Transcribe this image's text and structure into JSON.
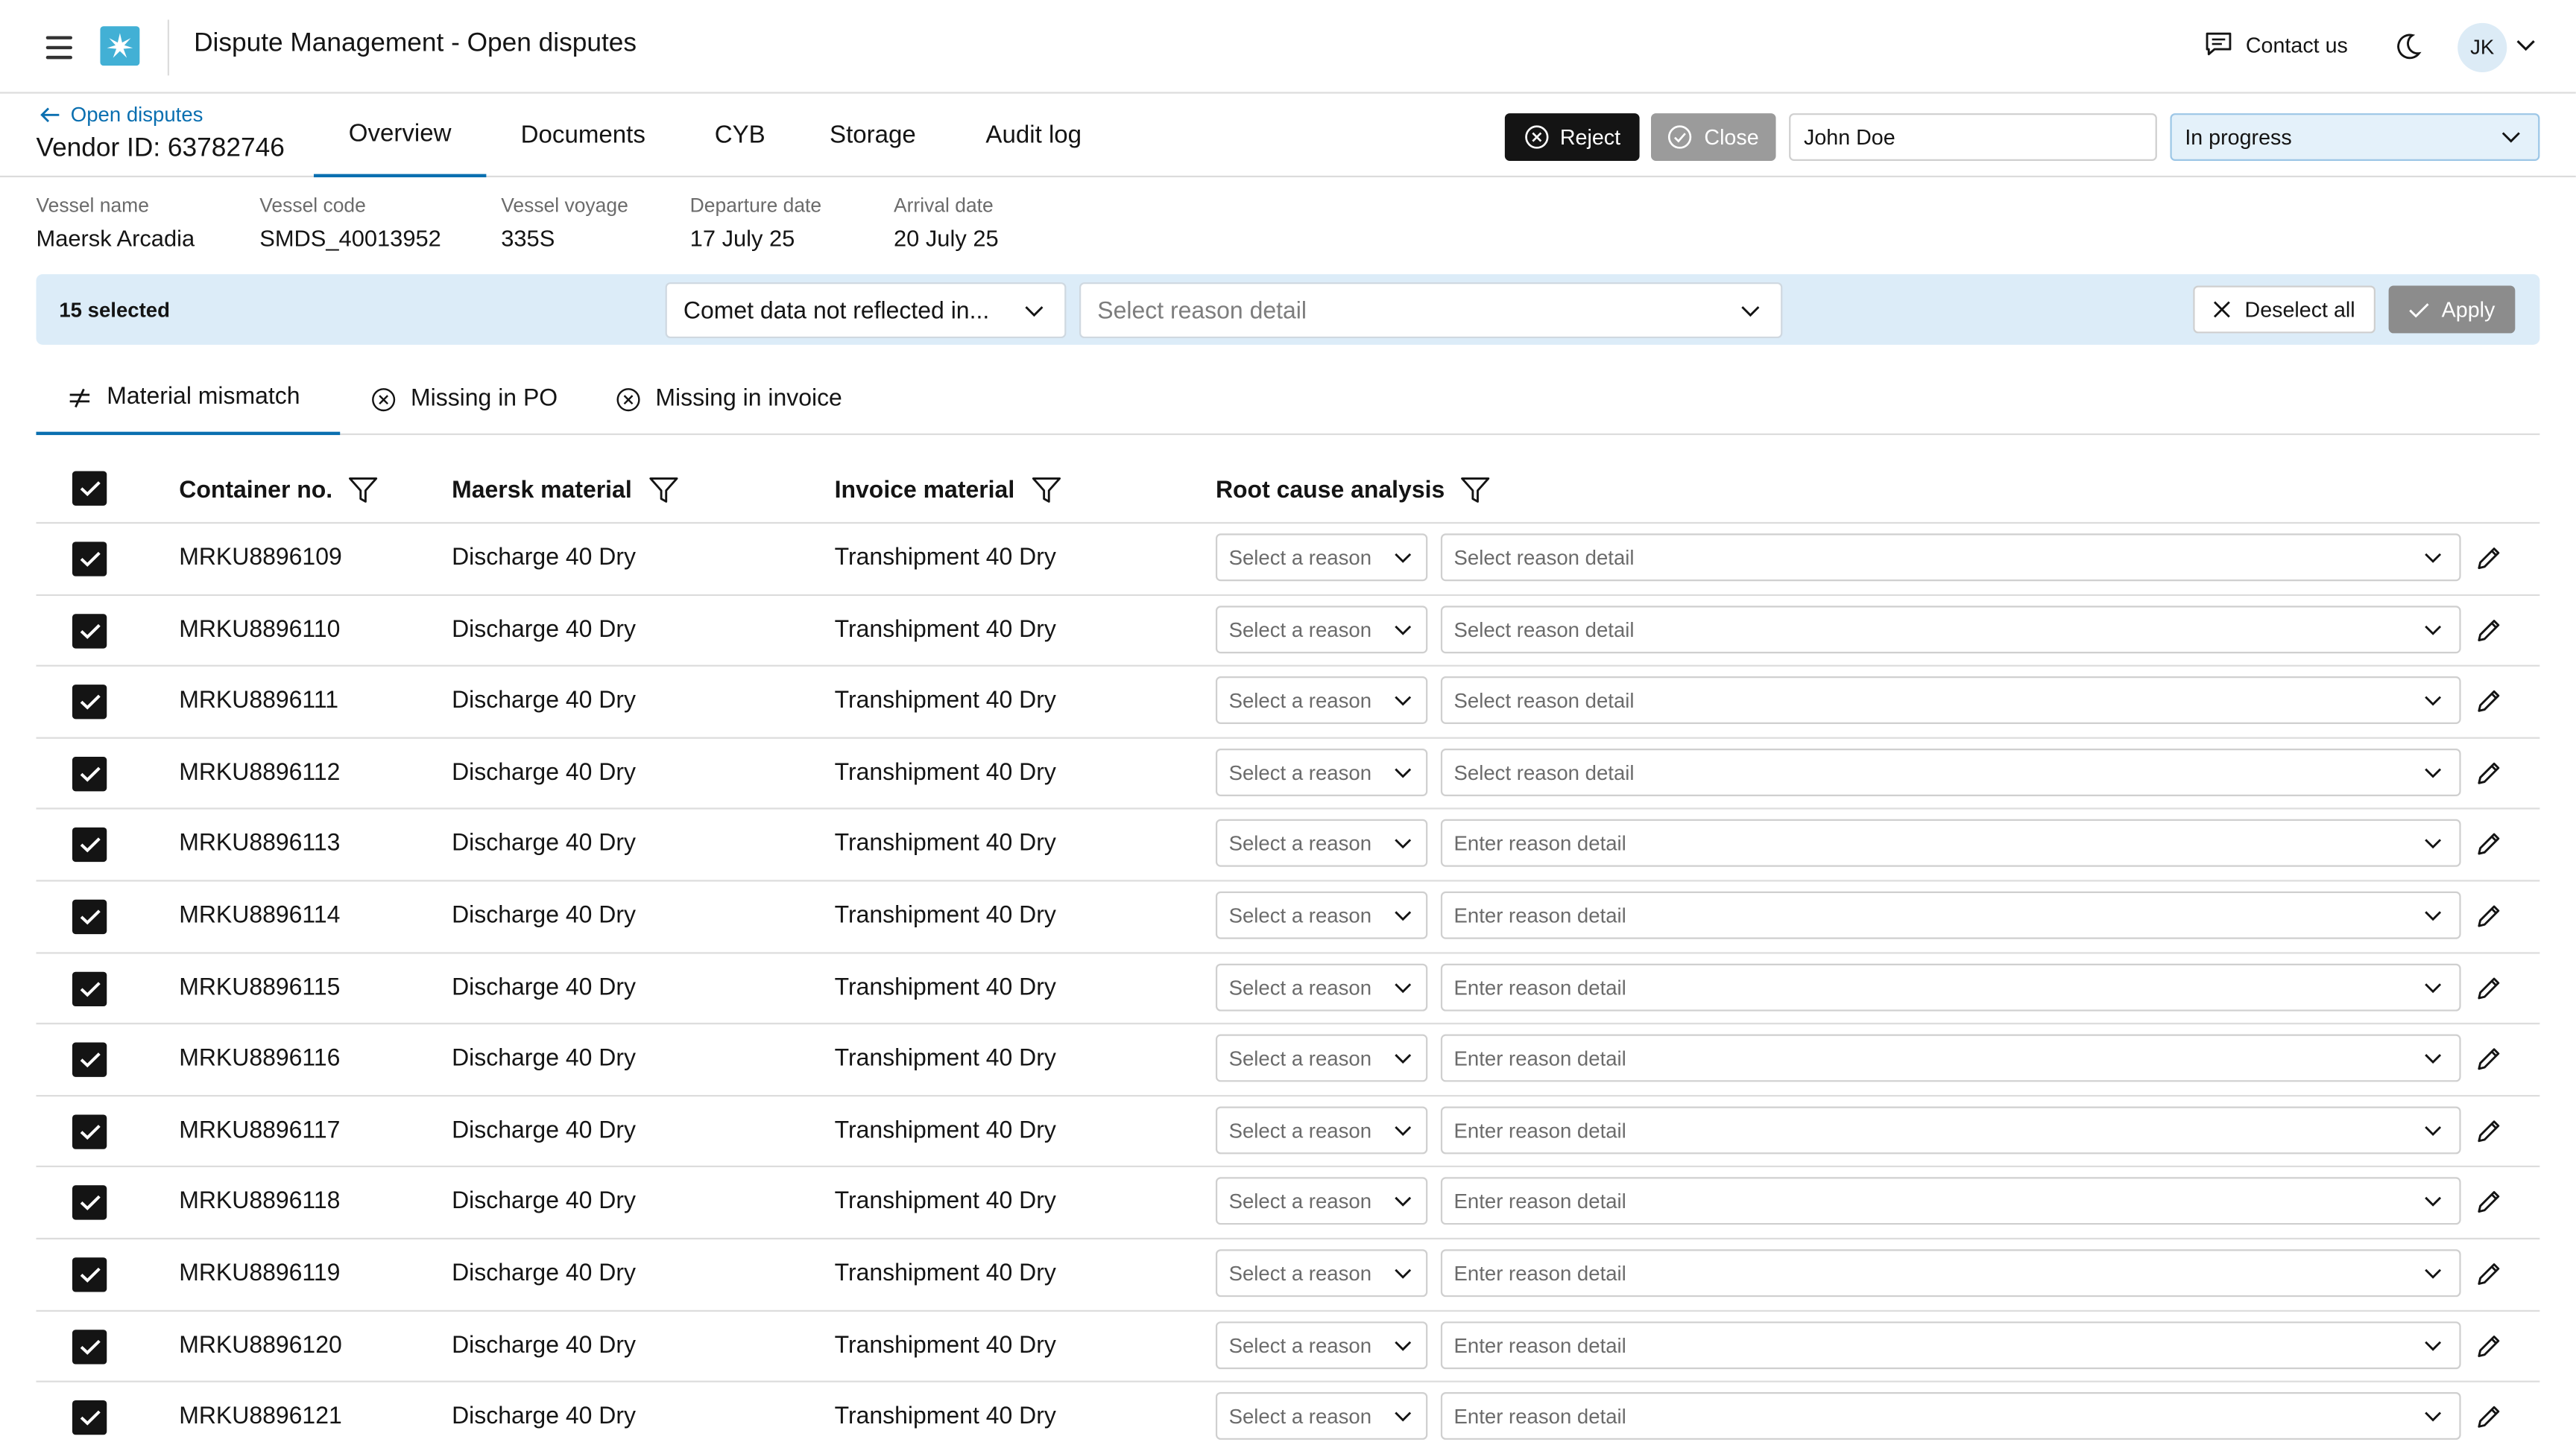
{
  "header": {
    "app_title": "Dispute Management - Open disputes",
    "contact_label": "Contact us",
    "avatar_initials": "JK",
    "brand_color": "#42b0d5"
  },
  "dispute": {
    "back_label": "Open disputes",
    "vendor_id": "Vendor ID: 63782746",
    "tabs": [
      {
        "label": "Overview",
        "active": true
      },
      {
        "label": "Documents",
        "active": false
      },
      {
        "label": "CYB",
        "active": false
      },
      {
        "label": "Storage",
        "active": false
      },
      {
        "label": "Audit log",
        "active": false
      }
    ],
    "reject_label": "Reject",
    "close_label": "Close",
    "assignee": "John Doe",
    "status": "In progress"
  },
  "vessel": {
    "fields": [
      {
        "label": "Vessel name",
        "value": "Maersk Arcadia"
      },
      {
        "label": "Vessel code",
        "value": "SMDS_40013952"
      },
      {
        "label": "Vessel voyage",
        "value": "335S"
      },
      {
        "label": "Departure date",
        "value": "17 July 25"
      },
      {
        "label": "Arrival date",
        "value": "20 July 25"
      }
    ]
  },
  "bulk": {
    "selected_count": "15 selected",
    "reason_value": "Comet data not reflected in...",
    "detail_placeholder": "Select reason detail",
    "deselect_label": "Deselect all",
    "apply_label": "Apply"
  },
  "subtabs": [
    {
      "label": "Material mismatch",
      "icon": "not-equal-icon",
      "active": true
    },
    {
      "label": "Missing in PO",
      "icon": "circle-x-icon",
      "active": false
    },
    {
      "label": "Missing in invoice",
      "icon": "circle-x-icon",
      "active": false
    }
  ],
  "table": {
    "columns": [
      "Container no.",
      "Maersk material",
      "Invoice material",
      "Root cause analysis"
    ],
    "rows": [
      {
        "container": "MRKU8896109",
        "maersk": "Discharge 40 Dry",
        "invoice": "Transhipment 40 Dry",
        "reason": "Select a reason",
        "detail": "Select reason detail",
        "checked": true
      },
      {
        "container": "MRKU8896110",
        "maersk": "Discharge 40 Dry",
        "invoice": "Transhipment 40 Dry",
        "reason": "Select a reason",
        "detail": "Select reason detail",
        "checked": true
      },
      {
        "container": "MRKU8896111",
        "maersk": "Discharge 40 Dry",
        "invoice": "Transhipment 40 Dry",
        "reason": "Select a reason",
        "detail": "Select reason detail",
        "checked": true
      },
      {
        "container": "MRKU8896112",
        "maersk": "Discharge 40 Dry",
        "invoice": "Transhipment 40 Dry",
        "reason": "Select a reason",
        "detail": "Select reason detail",
        "checked": true
      },
      {
        "container": "MRKU8896113",
        "maersk": "Discharge 40 Dry",
        "invoice": "Transhipment 40 Dry",
        "reason": "Select a reason",
        "detail": "Enter reason detail",
        "checked": true
      },
      {
        "container": "MRKU8896114",
        "maersk": "Discharge 40 Dry",
        "invoice": "Transhipment 40 Dry",
        "reason": "Select a reason",
        "detail": "Enter reason detail",
        "checked": true
      },
      {
        "container": "MRKU8896115",
        "maersk": "Discharge 40 Dry",
        "invoice": "Transhipment 40 Dry",
        "reason": "Select a reason",
        "detail": "Enter reason detail",
        "checked": true
      },
      {
        "container": "MRKU8896116",
        "maersk": "Discharge 40 Dry",
        "invoice": "Transhipment 40 Dry",
        "reason": "Select a reason",
        "detail": "Enter reason detail",
        "checked": true
      },
      {
        "container": "MRKU8896117",
        "maersk": "Discharge 40 Dry",
        "invoice": "Transhipment 40 Dry",
        "reason": "Select a reason",
        "detail": "Enter reason detail",
        "checked": true
      },
      {
        "container": "MRKU8896118",
        "maersk": "Discharge 40 Dry",
        "invoice": "Transhipment 40 Dry",
        "reason": "Select a reason",
        "detail": "Enter reason detail",
        "checked": true
      },
      {
        "container": "MRKU8896119",
        "maersk": "Discharge 40 Dry",
        "invoice": "Transhipment 40 Dry",
        "reason": "Select a reason",
        "detail": "Enter reason detail",
        "checked": true
      },
      {
        "container": "MRKU8896120",
        "maersk": "Discharge 40 Dry",
        "invoice": "Transhipment 40 Dry",
        "reason": "Select a reason",
        "detail": "Enter reason detail",
        "checked": true
      },
      {
        "container": "MRKU8896121",
        "maersk": "Discharge 40 Dry",
        "invoice": "Transhipment 40 Dry",
        "reason": "Select a reason",
        "detail": "Enter reason detail",
        "checked": true
      }
    ]
  }
}
